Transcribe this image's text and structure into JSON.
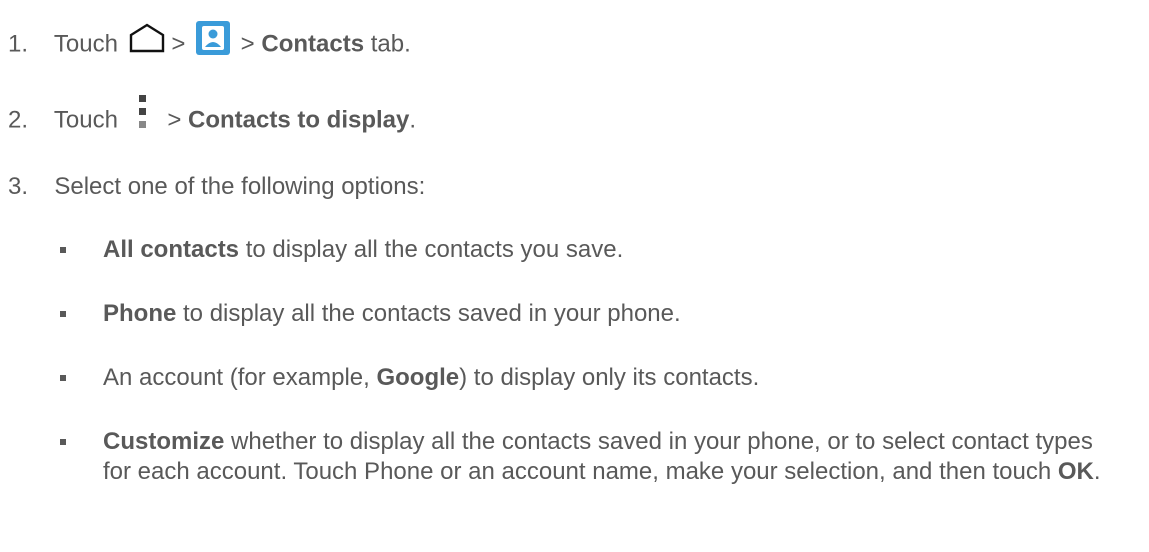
{
  "steps": [
    {
      "number": "1.",
      "prefix": "Touch",
      "sep1": ">",
      "sep2": ">",
      "bold": "Contacts",
      "suffix": "tab.",
      "icons": [
        "home-icon",
        "contacts-app-icon"
      ]
    },
    {
      "number": "2.",
      "prefix": "Touch",
      "sep": ">",
      "bold": "Contacts to display",
      "suffix": ".",
      "icons": [
        "menu-icon"
      ]
    },
    {
      "number": "3.",
      "text": "Select one of the following options:"
    }
  ],
  "options": [
    {
      "bold": "All contacts",
      "text": " to display all the contacts you save."
    },
    {
      "bold": "Phone",
      "text": " to display all the contacts saved in your phone."
    },
    {
      "pre": "An account (for example, ",
      "bold": "Google",
      "text": ") to display only its contacts."
    },
    {
      "bold": "Customize",
      "text": " whether to display all the contacts saved in your phone, or  to select contact types for each account. Touch Phone or an account name, make your selection, and then touch ",
      "bold2": "OK",
      "end": "."
    }
  ],
  "colors": {
    "text": "#595959",
    "contacts_icon_bg": "#3a9bd9",
    "bullet": "#595959"
  }
}
